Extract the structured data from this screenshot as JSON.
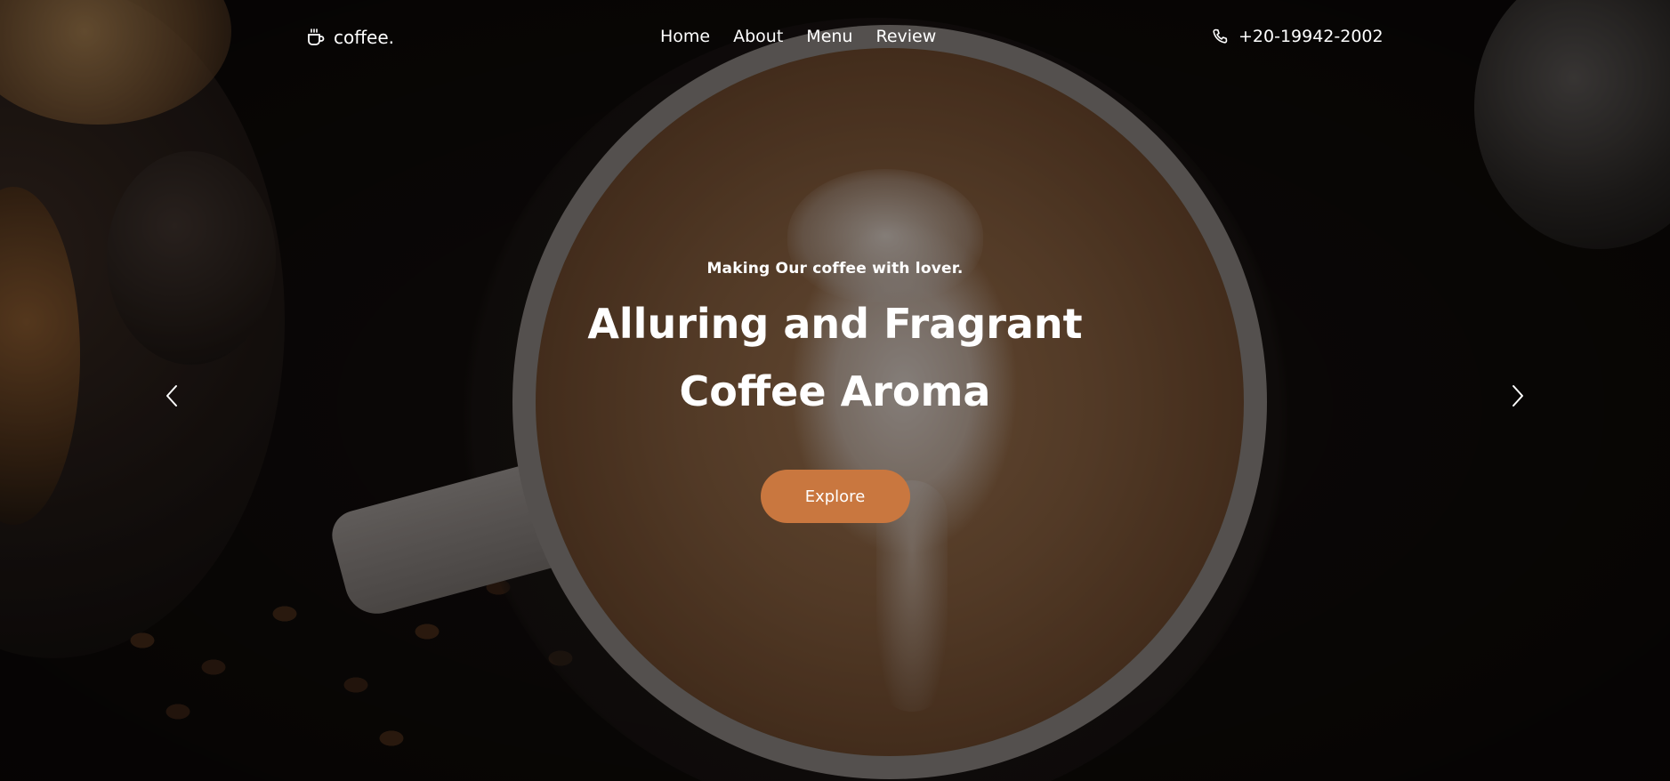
{
  "brand": {
    "name": "coffee.",
    "icon": "coffee-cup-icon"
  },
  "nav": {
    "items": [
      {
        "label": "Home"
      },
      {
        "label": "About"
      },
      {
        "label": "Menu"
      },
      {
        "label": "Review"
      }
    ]
  },
  "contact": {
    "phone": "+20-19942-2002",
    "icon": "phone-icon"
  },
  "hero": {
    "tagline": "Making Our coffee with lover.",
    "headline_line1": "Alluring and Fragrant",
    "headline_line2": "Coffee Aroma",
    "cta_label": "Explore",
    "prev_icon": "chevron-left-icon",
    "next_icon": "chevron-right-icon"
  },
  "colors": {
    "accent": "#c9773f",
    "text": "#ffffff"
  }
}
